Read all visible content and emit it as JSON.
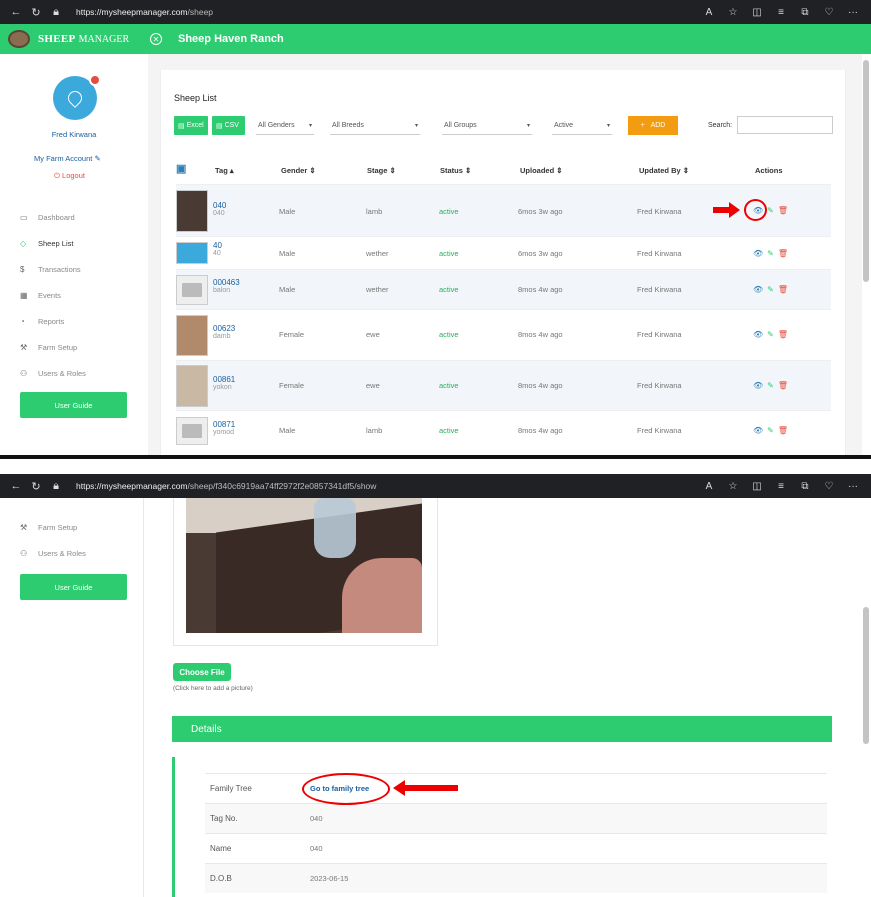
{
  "screen1": {
    "browser": {
      "url_domain": "https://mysheepmanager.com",
      "url_path": "/sheep"
    },
    "app": {
      "logo_bold": "SHEEP",
      "logo_rest": "MANAGER",
      "ranch": "Sheep Haven Ranch"
    },
    "sidebar": {
      "user_name": "Fred Kirwana",
      "farm_account": "My Farm Account",
      "logout": "Logout",
      "items": [
        {
          "label": "Dashboard",
          "icon": "monitor-icon"
        },
        {
          "label": "Sheep List",
          "icon": "tag-icon"
        },
        {
          "label": "Transactions",
          "icon": "dollar-icon"
        },
        {
          "label": "Events",
          "icon": "calendar-icon"
        },
        {
          "label": "Reports",
          "icon": "chart-icon"
        },
        {
          "label": "Farm Setup",
          "icon": "wrench-icon"
        },
        {
          "label": "Users & Roles",
          "icon": "users-icon"
        }
      ],
      "user_guide": "User Guide"
    },
    "list": {
      "title": "Sheep List",
      "excel": "Excel",
      "csv": "CSV",
      "gender_filter": "All Genders",
      "breed_filter": "All Breeds",
      "group_filter": "All Groups",
      "status_filter": "Active",
      "add": "ADD",
      "search_label": "Search:",
      "columns": [
        "Tag",
        "Gender",
        "Stage",
        "Status",
        "Uploaded",
        "Updated By",
        "Actions"
      ],
      "rows": [
        {
          "tag": "040",
          "sub": "040",
          "gender": "Male",
          "stage": "lamb",
          "status": "active",
          "uploaded": "6mos 3w ago",
          "updated_by": "Fred Kirwana"
        },
        {
          "tag": "40",
          "sub": "40",
          "gender": "Male",
          "stage": "wether",
          "status": "active",
          "uploaded": "6mos 3w ago",
          "updated_by": "Fred Kirwana"
        },
        {
          "tag": "000463",
          "sub": "balon",
          "gender": "Male",
          "stage": "wether",
          "status": "active",
          "uploaded": "8mos 4w ago",
          "updated_by": "Fred Kirwana"
        },
        {
          "tag": "00623",
          "sub": "damb",
          "gender": "Female",
          "stage": "ewe",
          "status": "active",
          "uploaded": "8mos 4w ago",
          "updated_by": "Fred Kirwana"
        },
        {
          "tag": "00861",
          "sub": "yokon",
          "gender": "Female",
          "stage": "ewe",
          "status": "active",
          "uploaded": "8mos 4w ago",
          "updated_by": "Fred Kirwana"
        },
        {
          "tag": "00871",
          "sub": "yomod",
          "gender": "Male",
          "stage": "lamb",
          "status": "active",
          "uploaded": "8mos 4w ago",
          "updated_by": "Fred Kirwana"
        }
      ]
    }
  },
  "screen2": {
    "browser": {
      "url_domain": "https://mysheepmanager.com",
      "url_path": "/sheep/f340c6919aa74ff2972f2e0857341df5/show"
    },
    "sidebar": {
      "farm_setup": "Farm Setup",
      "users_roles": "Users & Roles",
      "user_guide": "User Guide"
    },
    "choose_file": "Choose File",
    "hint": "(Click here to add a picture)",
    "details_title": "Details",
    "details": [
      {
        "key": "Family Tree",
        "value": "Go to family tree"
      },
      {
        "key": "Tag No.",
        "value": "040"
      },
      {
        "key": "Name",
        "value": "040"
      },
      {
        "key": "D.O.B",
        "value": "2023-06-15"
      }
    ]
  },
  "colors": {
    "accent": "#2ecc71",
    "add_button": "#f39c12",
    "link": "#1a5fa0",
    "delete": "#e74c3c",
    "annotation": "#e00000"
  }
}
